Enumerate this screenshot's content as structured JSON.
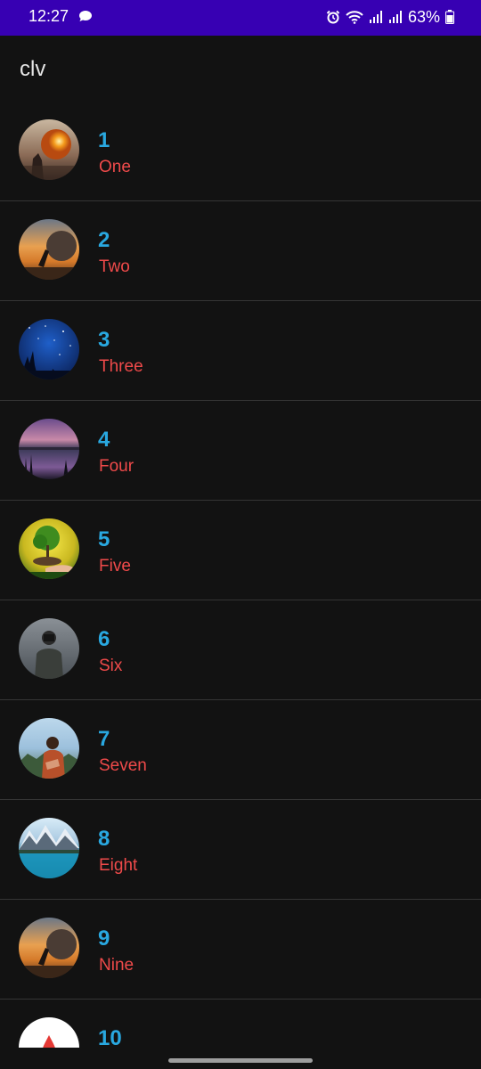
{
  "status_bar": {
    "time": "12:27",
    "battery": "63%",
    "icons": [
      "message-icon",
      "alarm-icon",
      "wifi-icon",
      "signal-icon",
      "signal-icon",
      "battery-icon"
    ]
  },
  "app_bar": {
    "title": "clv"
  },
  "list": {
    "items": [
      {
        "number": "1",
        "label": "One",
        "image": "sunset-bubble-photo"
      },
      {
        "number": "2",
        "label": "Two",
        "image": "person-pushing-rock-photo"
      },
      {
        "number": "3",
        "label": "Three",
        "image": "starry-night-photo"
      },
      {
        "number": "4",
        "label": "Four",
        "image": "lake-dusk-photo"
      },
      {
        "number": "5",
        "label": "Five",
        "image": "tree-in-hand-photo"
      },
      {
        "number": "6",
        "label": "Six",
        "image": "photographer-photo"
      },
      {
        "number": "7",
        "label": "Seven",
        "image": "couple-hug-photo"
      },
      {
        "number": "8",
        "label": "Eight",
        "image": "mountain-lake-photo"
      },
      {
        "number": "9",
        "label": "Nine",
        "image": "person-pushing-rock-photo"
      },
      {
        "number": "10",
        "label": "",
        "image": "blood-drop-logo"
      }
    ]
  },
  "colors": {
    "status_bar_bg": "#3700b3",
    "background": "#121212",
    "number_text": "#29a8e0",
    "label_text": "#ef4a4a",
    "divider": "#353535"
  }
}
